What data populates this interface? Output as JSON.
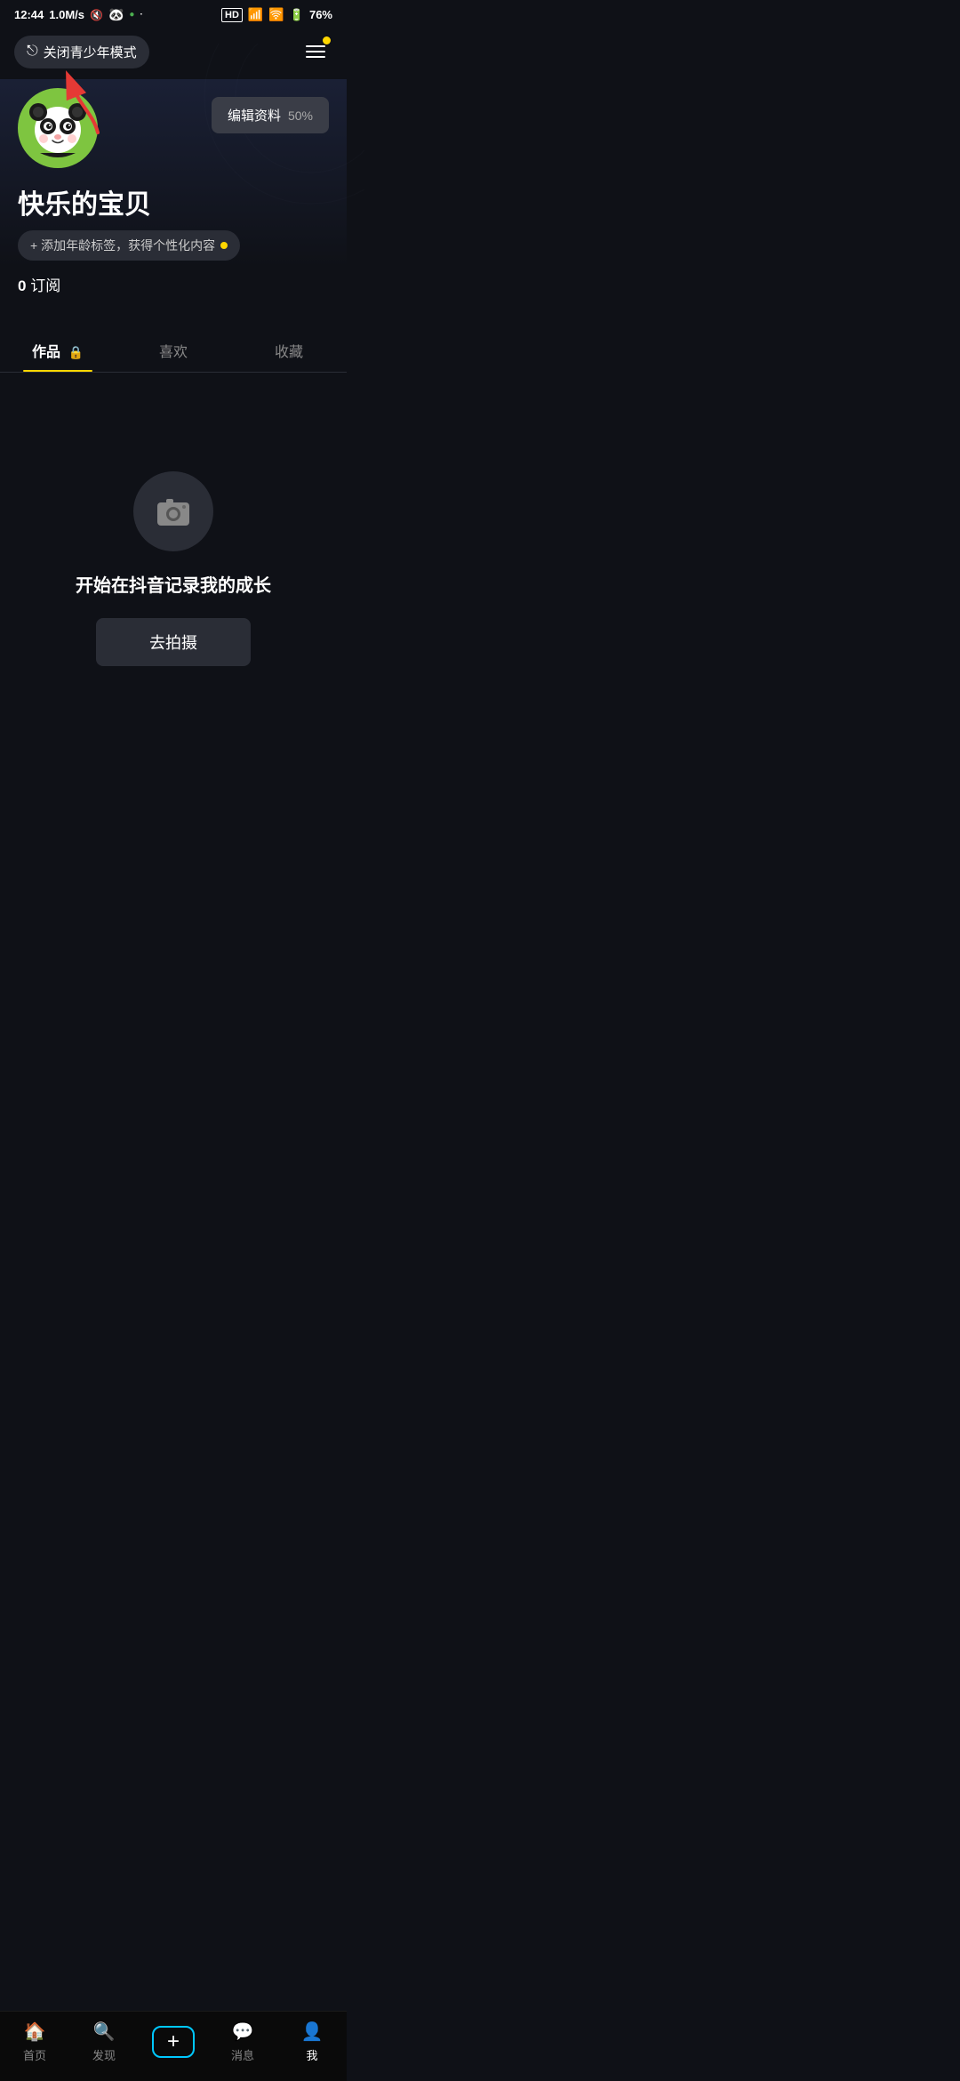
{
  "statusBar": {
    "time": "12:44",
    "speed": "1.0M/s",
    "battery": "76%"
  },
  "topNav": {
    "youthModeLabel": "关闭青少年模式",
    "menuLabel": "菜单"
  },
  "profile": {
    "editBtnLabel": "编辑资料",
    "editPercent": "50%",
    "username": "快乐的宝贝",
    "ageTagLabel": "+ 添加年龄标签，获得个性化内容",
    "subscriptionsCount": "0",
    "subscriptionsLabel": "订阅"
  },
  "tabs": [
    {
      "label": "作品",
      "active": true,
      "hasLock": true
    },
    {
      "label": "喜欢",
      "active": false,
      "hasLock": false
    },
    {
      "label": "收藏",
      "active": false,
      "hasLock": false
    }
  ],
  "emptyState": {
    "title": "开始在抖音记录我的成长",
    "shootBtnLabel": "去拍摄"
  },
  "bottomNav": [
    {
      "label": "首页",
      "active": false
    },
    {
      "label": "发现",
      "active": false
    },
    {
      "label": "+",
      "active": false,
      "isPlus": true
    },
    {
      "label": "消息",
      "active": false
    },
    {
      "label": "我",
      "active": true
    }
  ]
}
